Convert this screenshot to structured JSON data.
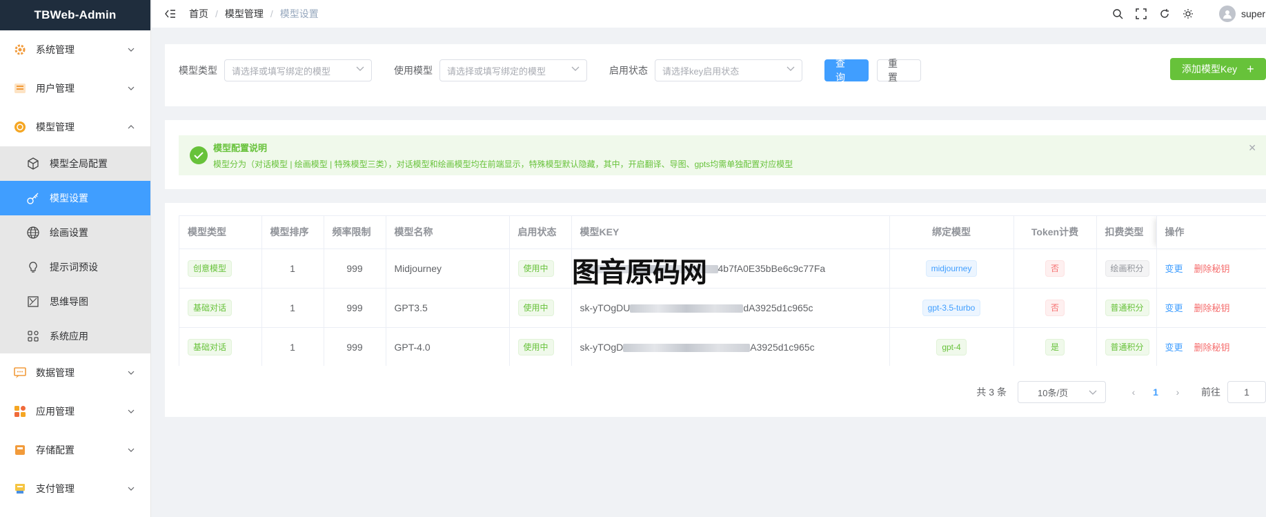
{
  "sidebar": {
    "brand": "TBWeb-Admin",
    "menus": [
      {
        "label": "系统管理",
        "icon": "gear-icon",
        "color": "#f29b3b"
      },
      {
        "label": "用户管理",
        "icon": "user-card-icon",
        "color": "#f29b3b"
      },
      {
        "label": "模型管理",
        "icon": "model-icon",
        "color": "#f5a623"
      }
    ],
    "submenu": [
      {
        "label": "模型全局配置",
        "icon": "cube-icon"
      },
      {
        "label": "模型设置",
        "icon": "key-icon"
      },
      {
        "label": "绘画设置",
        "icon": "globe-icon"
      },
      {
        "label": "提示词预设",
        "icon": "bulb-icon"
      },
      {
        "label": "思维导图",
        "icon": "mindmap-icon"
      },
      {
        "label": "系统应用",
        "icon": "apps-icon"
      }
    ],
    "menus_bottom": [
      {
        "label": "数据管理",
        "icon": "chat-data-icon"
      },
      {
        "label": "应用管理",
        "icon": "app-grid-icon"
      },
      {
        "label": "存储配置",
        "icon": "storage-icon"
      },
      {
        "label": "支付管理",
        "icon": "payment-icon"
      }
    ]
  },
  "header": {
    "breadcrumb": [
      "首页",
      "模型管理",
      "模型设置"
    ],
    "user": "super"
  },
  "search": {
    "fields": [
      {
        "label": "模型类型",
        "placeholder": "请选择或填写绑定的模型"
      },
      {
        "label": "使用模型",
        "placeholder": "请选择或填写绑定的模型"
      },
      {
        "label": "启用状态",
        "placeholder": "请选择key启用状态"
      }
    ],
    "query_label": "查询",
    "reset_label": "重置",
    "add_label": "添加模型Key"
  },
  "alert": {
    "title": "模型配置说明",
    "desc": "模型分为（对话模型 | 绘画模型 | 特殊模型三类），对话模型和绘画模型均在前端显示，特殊模型默认隐藏，其中，开启翻译、导图、gpts均需单独配置对应模型"
  },
  "table": {
    "columns": [
      "模型类型",
      "模型排序",
      "频率限制",
      "模型名称",
      "启用状态",
      "模型KEY",
      "绑定模型",
      "Token计费",
      "扣费类型",
      "操作"
    ],
    "rows": [
      {
        "type": "创意模型",
        "order": "1",
        "rate": "999",
        "name": "Midjourney",
        "status": "使用中",
        "key_prefix": "",
        "key_suffix": "4b7fA0E35bBe6c9c77Fa",
        "bind": "midjourney",
        "token": "否",
        "deduct": "绘画积分",
        "edit": "变更",
        "del": "删除秘钥"
      },
      {
        "type": "基础对话",
        "order": "1",
        "rate": "999",
        "name": "GPT3.5",
        "status": "使用中",
        "key_prefix": "sk-yTOgDU",
        "key_suffix": "dA3925d1c965c",
        "bind": "gpt-3.5-turbo",
        "token": "否",
        "deduct": "普通积分",
        "edit": "变更",
        "del": "删除秘钥"
      },
      {
        "type": "基础对话",
        "order": "1",
        "rate": "999",
        "name": "GPT-4.0",
        "status": "使用中",
        "key_prefix": "sk-yTOgD",
        "key_suffix": "A3925d1c965c",
        "bind": "gpt-4",
        "token": "是",
        "deduct": "普通积分",
        "edit": "变更",
        "del": "删除秘钥"
      }
    ]
  },
  "watermark": "图音原码网",
  "pagination": {
    "total": "共 3 条",
    "page_size": "10条/页",
    "current": "1",
    "goto_label": "前往",
    "goto_value": "1"
  }
}
